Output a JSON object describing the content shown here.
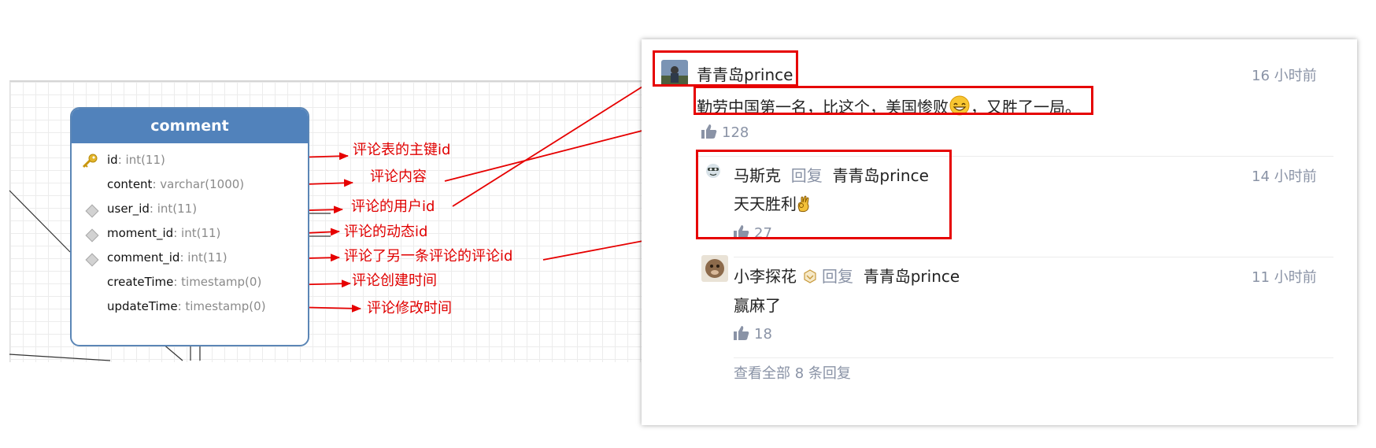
{
  "entity": {
    "name": "comment",
    "fields": [
      {
        "name": "id",
        "type": ": int(11)",
        "icon": "key-icon"
      },
      {
        "name": "content",
        "type": ": varchar(1000)",
        "icon": ""
      },
      {
        "name": "user_id",
        "type": ": int(11)",
        "icon": "diamond-icon"
      },
      {
        "name": "moment_id",
        "type": ": int(11)",
        "icon": "diamond-icon"
      },
      {
        "name": "comment_id",
        "type": ": int(11)",
        "icon": "diamond-icon"
      },
      {
        "name": "createTime",
        "type": ": timestamp(0)",
        "icon": ""
      },
      {
        "name": "updateTime",
        "type": ": timestamp(0)",
        "icon": ""
      }
    ]
  },
  "annotations": [
    "评论表的主键id",
    "评论内容",
    "评论的用户id",
    "评论的动态id",
    "评论了另一条评论的评论id",
    "评论创建时间",
    "评论修改时间"
  ],
  "comments": {
    "main": {
      "user": "青青岛prince",
      "time": "16 小时前",
      "text_a": "勤劳中国第一名，比这个，美国惨败",
      "text_b": "，又胜了一局。",
      "likes": "128"
    },
    "replies": [
      {
        "user": "马斯克",
        "reply_word": "回复",
        "target": "青青岛prince",
        "time": "14 小时前",
        "text": "天天胜利",
        "likes": "27"
      },
      {
        "user": "小李探花",
        "reply_word": "回复",
        "target": "青青岛prince",
        "time": "11 小时前",
        "text": "赢麻了",
        "likes": "18"
      }
    ],
    "view_all": "查看全部 8 条回复"
  },
  "colors": {
    "annotation": "#e00000",
    "header": "#5182bb",
    "muted": "#8a93a6"
  }
}
